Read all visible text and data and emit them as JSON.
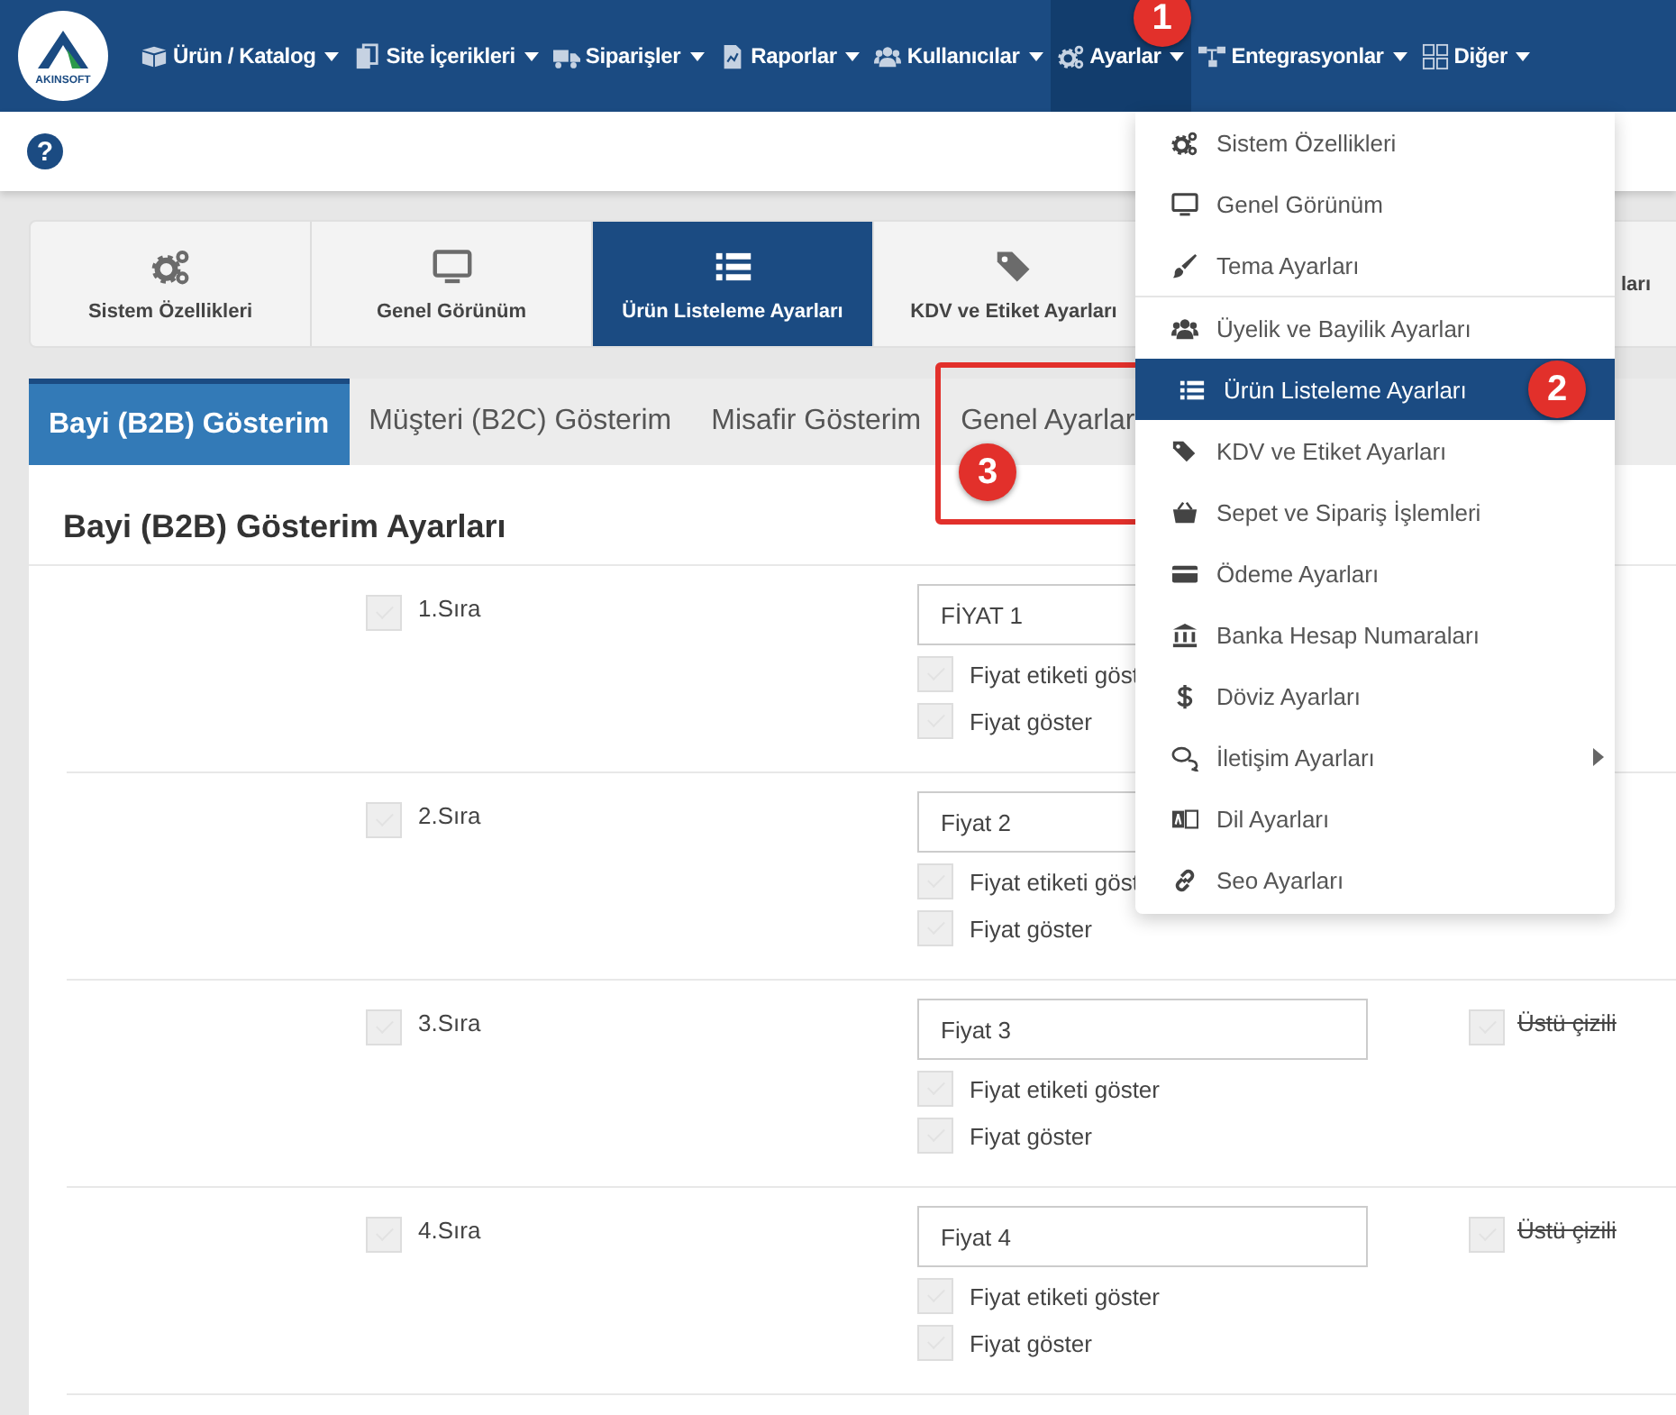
{
  "logo": {
    "text": "AKINSOFT"
  },
  "nav": [
    {
      "label": "Ürün / Katalog",
      "kind": "boxes",
      "selected": false
    },
    {
      "label": "Site İçerikleri",
      "kind": "files",
      "selected": false
    },
    {
      "label": "Siparişler",
      "kind": "truck",
      "selected": false
    },
    {
      "label": "Raporlar",
      "kind": "report",
      "selected": false
    },
    {
      "label": "Kullanıcılar",
      "kind": "users",
      "selected": false
    },
    {
      "label": "Ayarlar",
      "kind": "gears",
      "selected": true,
      "badge": "1"
    },
    {
      "label": "Entegrasyonlar",
      "kind": "network",
      "selected": false
    },
    {
      "label": "Diğer",
      "kind": "grid",
      "selected": false
    }
  ],
  "help": {
    "label": "?"
  },
  "settings_tabs": [
    {
      "label": "Sistem Özellikleri",
      "kind": "gears",
      "selected": false
    },
    {
      "label": "Genel Görünüm",
      "kind": "monitor",
      "selected": false
    },
    {
      "label": "Ürün Listeleme Ayarları",
      "kind": "list",
      "selected": true
    },
    {
      "label": "KDV ve Etiket Ayarları",
      "kind": "tag",
      "selected": false
    },
    {
      "label": "ları",
      "kind": "none",
      "selected": false
    }
  ],
  "sub_tabs": [
    {
      "label": "Bayi (B2B) Gösterim",
      "selected": true
    },
    {
      "label": "Müşteri (B2C) Gösterim",
      "selected": false
    },
    {
      "label": "Misafir Gösterim",
      "selected": false
    },
    {
      "label": "Genel Ayarlar",
      "selected": false,
      "callout": "3"
    }
  ],
  "section_title": "Bayi (B2B) Gösterim Ayarları",
  "rows": [
    {
      "label": "1.Sıra",
      "checked": false,
      "price": "FİYAT 1",
      "options": [
        {
          "label": "Fiyat etiketi göst",
          "checked": false
        },
        {
          "label": "Fiyat göster",
          "checked": false
        }
      ]
    },
    {
      "label": "2.Sıra",
      "checked": false,
      "price": "Fiyat 2",
      "options": [
        {
          "label": "Fiyat etiketi göst",
          "checked": false
        },
        {
          "label": "Fiyat göster",
          "checked": false
        }
      ]
    },
    {
      "label": "3.Sıra",
      "checked": false,
      "price": "Fiyat 3",
      "options": [
        {
          "label": "Fiyat etiketi göster",
          "checked": false
        },
        {
          "label": "Fiyat göster",
          "checked": false
        }
      ],
      "strike": {
        "label": "Üstü çizili",
        "checked": false
      }
    },
    {
      "label": "4.Sıra",
      "checked": false,
      "price": "Fiyat 4",
      "options": [
        {
          "label": "Fiyat etiketi göster",
          "checked": false
        },
        {
          "label": "Fiyat göster",
          "checked": false
        }
      ],
      "strike": {
        "label": "Üstü çizili",
        "checked": false
      }
    }
  ],
  "menu": {
    "groups": [
      [
        {
          "label": "Sistem Özellikleri",
          "kind": "gears",
          "selected": false
        },
        {
          "label": "Genel Görünüm",
          "kind": "monitor",
          "selected": false
        },
        {
          "label": "Tema Ayarları",
          "kind": "brush",
          "selected": false
        }
      ],
      [
        {
          "label": "Üyelik ve Bayilik Ayarları",
          "kind": "users",
          "selected": false
        },
        {
          "label": "Ürün Listeleme Ayarları",
          "kind": "list",
          "selected": true,
          "badge": "2"
        },
        {
          "label": "KDV ve Etiket Ayarları",
          "kind": "tag",
          "selected": false
        },
        {
          "label": "Sepet ve Sipariş İşlemleri",
          "kind": "basket",
          "selected": false
        },
        {
          "label": "Ödeme Ayarları",
          "kind": "card",
          "selected": false
        },
        {
          "label": "Banka Hesap Numaraları",
          "kind": "bank",
          "selected": false
        },
        {
          "label": "Döviz Ayarları",
          "kind": "dollar",
          "selected": false
        },
        {
          "label": "İletişim Ayarları",
          "kind": "chat",
          "selected": false,
          "submenu": true
        },
        {
          "label": "Dil Ayarları",
          "kind": "language",
          "selected": false
        },
        {
          "label": "Seo Ayarları",
          "kind": "link",
          "selected": false
        }
      ]
    ]
  }
}
